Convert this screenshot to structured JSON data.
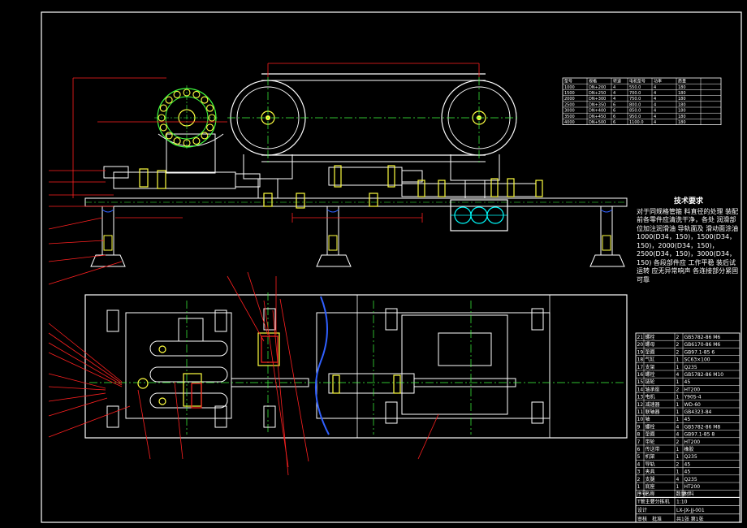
{
  "drawing": {
    "tech_title": "技术要求",
    "tech_body": "对于同规格管箍 料直径的处理 装配前各零件应清洗干净，各处 润滑部位加注润滑油 导轨面及 滑动面涂油 1000(D34，150)，1500(D34，150)，2000(D34，150)，2500(D34，150)，3000(D34，150) 各段部件应 工作平稳 装后试运转 应无异常响声 各连接部分紧固可靠"
  },
  "top_table": {
    "headers": [
      "型号",
      "规格",
      "转速",
      "电机型号",
      "功率",
      "质量"
    ],
    "rows": [
      [
        "1000",
        "DN+200",
        "4",
        "550.0",
        "4",
        "180"
      ],
      [
        "1500",
        "DN+250",
        "4",
        "700.0",
        "4",
        "180"
      ],
      [
        "2000",
        "DN+300",
        "4",
        "750.0",
        "4",
        "180"
      ],
      [
        "2500",
        "DN+350",
        "6",
        "800.0",
        "4",
        "180"
      ],
      [
        "3000",
        "DN+400",
        "6",
        "850.0",
        "4",
        "180"
      ],
      [
        "3500",
        "DN+450",
        "6",
        "950.0",
        "4",
        "180"
      ],
      [
        "4000",
        "DN+500",
        "6",
        "1100.0",
        "4",
        "180"
      ]
    ]
  },
  "parts_list": {
    "rows": [
      [
        "21",
        "螺栓",
        "2",
        "GB5782-86 M6"
      ],
      [
        "20",
        "螺母",
        "2",
        "GB6170-86 M6"
      ],
      [
        "19",
        "垫圈",
        "2",
        "GB97.1-85 6"
      ],
      [
        "18",
        "气缸",
        "1",
        "SC63×100"
      ],
      [
        "17",
        "支架",
        "1",
        "Q235"
      ],
      [
        "16",
        "螺栓",
        "4",
        "GB5782-86 M10"
      ],
      [
        "15",
        "链轮",
        "1",
        "45"
      ],
      [
        "14",
        "轴承座",
        "2",
        "HT200"
      ],
      [
        "13",
        "电机",
        "1",
        "Y90S-4"
      ],
      [
        "12",
        "减速器",
        "1",
        "WD-60"
      ],
      [
        "11",
        "联轴器",
        "1",
        "GB4323-84"
      ],
      [
        "10",
        "轴",
        "1",
        "45"
      ],
      [
        "9",
        "螺栓",
        "4",
        "GB5782-86 M8"
      ],
      [
        "8",
        "垫圈",
        "4",
        "GB97.1-85 8"
      ],
      [
        "7",
        "带轮",
        "2",
        "HT200"
      ],
      [
        "6",
        "传送带",
        "1",
        "橡胶"
      ],
      [
        "5",
        "机架",
        "1",
        "Q235"
      ],
      [
        "4",
        "导轨",
        "2",
        "45"
      ],
      [
        "3",
        "夹具",
        "1",
        "45"
      ],
      [
        "2",
        "支腿",
        "4",
        "Q235"
      ],
      [
        "1",
        "底座",
        "1",
        "HT200"
      ]
    ],
    "footer": [
      "序号",
      "名称",
      "数量",
      "材料",
      "备注"
    ],
    "title_block": {
      "title": "T管主要分拣机",
      "drawing_no": "LX-JX-JJ-001",
      "designer": "设计",
      "checker": "审核",
      "approver": "批准",
      "scale": "1:10",
      "sheet": "共1张 第1张"
    }
  },
  "colors": {
    "background": "#000000",
    "outline": "#ffffff",
    "dimension": "#ff2020",
    "centerline": "#40ff40",
    "hidden": "#3060ff",
    "part": "#ffff40",
    "accent": "#00ffff"
  }
}
